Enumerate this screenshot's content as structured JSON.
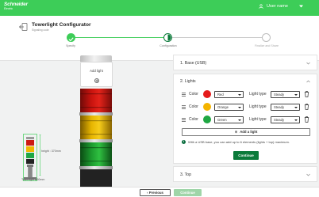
{
  "brand": {
    "name": "Schneider",
    "sub": "Electric"
  },
  "user": {
    "name": "User name",
    "icon": "user-icon"
  },
  "header": {
    "title": "Towerlight Configurator",
    "subtitle": "Signaling code",
    "exit_icon": "exit-icon"
  },
  "stepper": {
    "steps": [
      {
        "label": "Specify",
        "state": "done"
      },
      {
        "label": "Configuration",
        "state": "current"
      },
      {
        "label": "Finalize and Share",
        "state": "todo"
      }
    ],
    "colors": {
      "done": "#3dcd58",
      "current": "#0b7a3a",
      "todo": "#bdbdbd"
    }
  },
  "preview": {
    "add_light_label": "Add light",
    "height_label": "height : 370mm",
    "caption": "Towerlight ø60mm"
  },
  "sections": {
    "base": {
      "title": "1. Base (USB)"
    },
    "lights": {
      "title": "2. Lights"
    },
    "top": {
      "title": "3. Top"
    }
  },
  "lights": [
    {
      "color_label": "Color",
      "swatch": "#e51b1b",
      "color": "Red",
      "type_label": "Light type",
      "type": "Steady"
    },
    {
      "color_label": "Color",
      "swatch": "#f4b400",
      "color": "Orange",
      "type_label": "Light type",
      "type": "Steady"
    },
    {
      "color_label": "Color",
      "swatch": "#1fa743",
      "color": "Green",
      "type_label": "Light type",
      "type": "Steady"
    }
  ],
  "add_light_button": "Add a light",
  "info_text": "With a USB base, you can add up to 6 elements (lights + top) maximum.",
  "continue_label": "Continue",
  "footer": {
    "previous": "Previous",
    "continue": "Continue"
  },
  "accent_color": "#3dcd58"
}
